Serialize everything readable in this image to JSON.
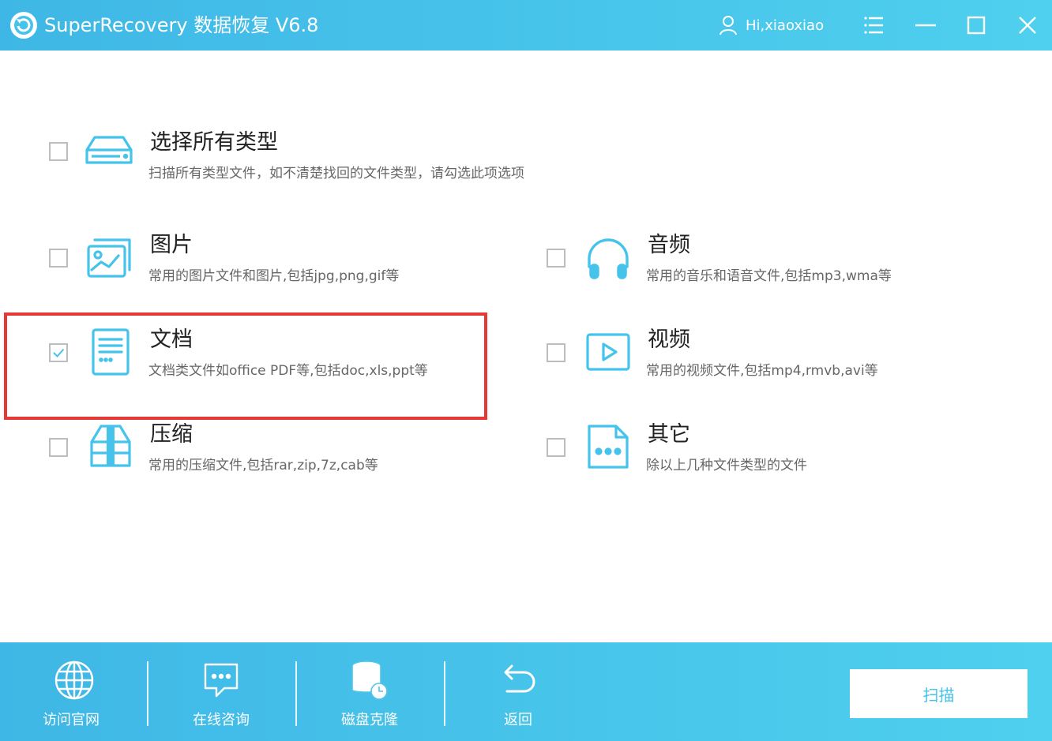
{
  "window": {
    "title": "SuperRecovery 数据恢复 V6.8",
    "user": "Hi,xiaoxiao",
    "controls": [
      "menu-icon",
      "minimize-icon",
      "maximize-icon",
      "close-icon"
    ]
  },
  "file_types": {
    "all": {
      "name": "选择所有类型",
      "desc": "扫描所有类型文件，如不清楚找回的文件类型，请勾选此项选项",
      "checked": false,
      "icon": "hard-drive-icon"
    },
    "picture": {
      "name": "图片",
      "desc": "常用的图片文件和图片,包括jpg,png,gif等",
      "checked": false,
      "icon": "picture-icon"
    },
    "audio": {
      "name": "音频",
      "desc": "常用的音乐和语音文件,包括mp3,wma等",
      "checked": false,
      "icon": "headphones-icon"
    },
    "document": {
      "name": "文档",
      "desc": "文档类文件如office PDF等,包括doc,xls,ppt等",
      "checked": true,
      "icon": "document-icon"
    },
    "video": {
      "name": "视频",
      "desc": "常用的视频文件,包括mp4,rmvb,avi等",
      "checked": false,
      "icon": "video-icon"
    },
    "archive": {
      "name": "压缩",
      "desc": "常用的压缩文件,包括rar,zip,7z,cab等",
      "checked": false,
      "icon": "archive-icon"
    },
    "other": {
      "name": "其它",
      "desc": "除以上几种文件类型的文件",
      "checked": false,
      "icon": "other-file-icon"
    }
  },
  "bottom": {
    "website": "访问官网",
    "consult": "在线咨询",
    "clone": "磁盘克隆",
    "back": "返回",
    "scan": "扫描"
  },
  "colors": {
    "accent": "#45c3ea",
    "highlight": "#e53935",
    "icon": "#45c3ea"
  }
}
